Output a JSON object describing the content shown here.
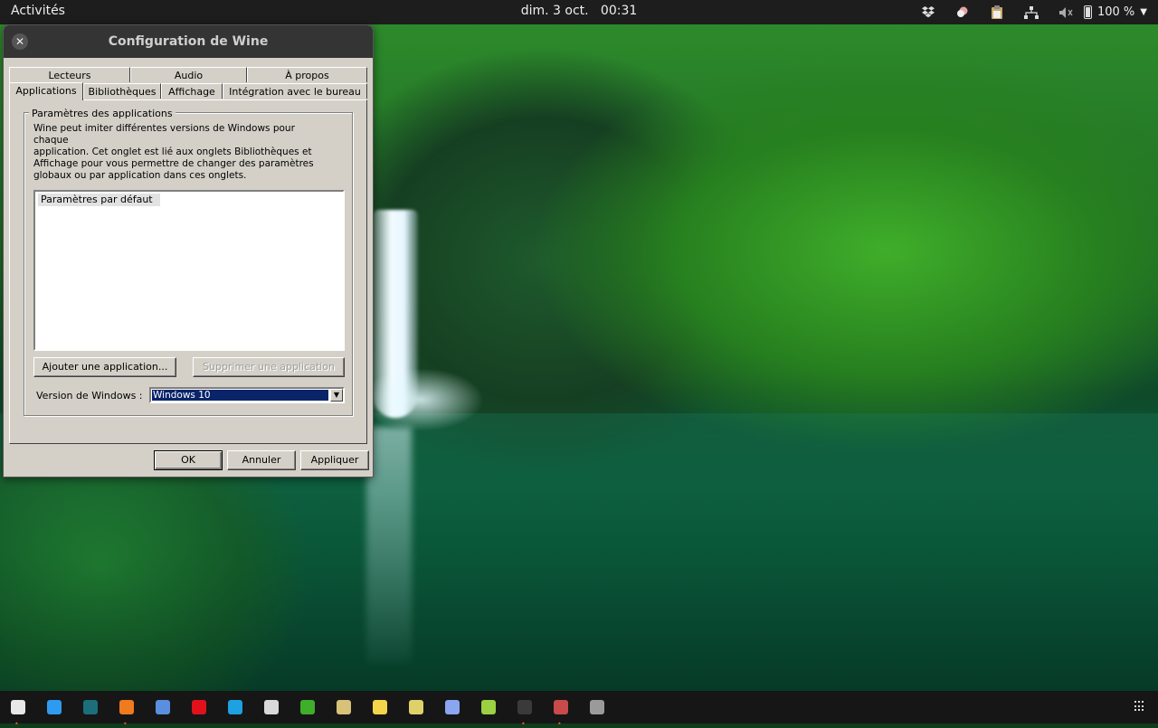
{
  "topbar": {
    "activities": "Activités",
    "clock": "dim. 3 oct.   00:31",
    "battery": "100 %",
    "tray_icons": [
      "dropbox-icon",
      "weather-icon",
      "clipboard-icon",
      "network-icon",
      "volume-muted-icon",
      "battery-icon"
    ]
  },
  "window": {
    "title": "Configuration de Wine",
    "tabs_row1": [
      "Lecteurs",
      "Audio",
      "À propos"
    ],
    "tabs_row2": [
      "Applications",
      "Bibliothèques",
      "Affichage",
      "Intégration avec le bureau"
    ],
    "active_tab": "Applications",
    "group_title": "Paramètres des applications",
    "description_lines": [
      "Wine peut imiter différentes versions de Windows pour chaque",
      "application. Cet onglet est lié aux onglets Bibliothèques et",
      "Affichage pour vous permettre de changer des paramètres",
      "globaux ou par application dans ces onglets."
    ],
    "list_items": [
      "Paramètres par défaut"
    ],
    "add_button": "Ajouter une application...",
    "remove_button": "Supprimer une application",
    "version_label": "Version de Windows :",
    "version_value": "Windows 10",
    "ok_button": "OK",
    "cancel_button": "Annuler",
    "apply_button": "Appliquer"
  },
  "dock": {
    "apps": [
      {
        "name": "files-icon",
        "color": "#e8e8e8",
        "running": true
      },
      {
        "name": "vscode-icon",
        "color": "#2f9bf0",
        "running": false
      },
      {
        "name": "gitkraken-icon",
        "color": "#1c6f7a",
        "running": false
      },
      {
        "name": "firefox-icon",
        "color": "#f07a1e",
        "running": true
      },
      {
        "name": "chromium-icon",
        "color": "#5a8fe0",
        "running": false
      },
      {
        "name": "opera-icon",
        "color": "#e0111b",
        "running": false
      },
      {
        "name": "skype-icon",
        "color": "#1da1e0",
        "running": false
      },
      {
        "name": "slack-icon",
        "color": "#d9d9d9",
        "running": false
      },
      {
        "name": "yandex-icon",
        "color": "#3fae2a",
        "running": false
      },
      {
        "name": "gimp-icon",
        "color": "#d8c27a",
        "running": false
      },
      {
        "name": "notes-icon",
        "color": "#f3d54a",
        "running": false
      },
      {
        "name": "calculator-icon",
        "color": "#e0d06a",
        "running": false
      },
      {
        "name": "screenshot-icon",
        "color": "#8aa6f0",
        "running": false
      },
      {
        "name": "gnome-software-icon",
        "color": "#9bd143",
        "running": false
      },
      {
        "name": "terminal-icon",
        "color": "#3a3a3a",
        "running": true
      },
      {
        "name": "wine-icon",
        "color": "#c94a4a",
        "running": true
      },
      {
        "name": "disk-icon",
        "color": "#9a9a9a",
        "running": false
      }
    ]
  }
}
